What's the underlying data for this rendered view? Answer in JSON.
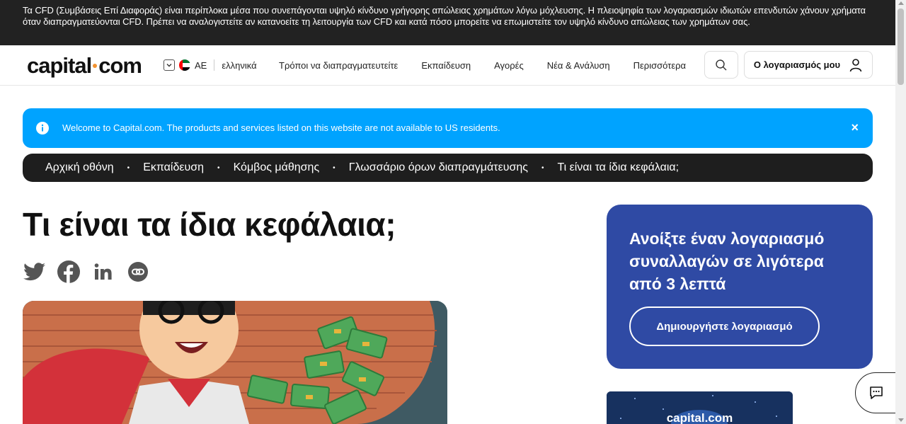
{
  "risk_warning": "Τα CFD (Συμβάσεις Επί Διαφοράς) είναι περίπλοκα μέσα που συνεπάγονται υψηλό κίνδυνο γρήγορης απώλειας χρημάτων λόγω μόχλευσης. Η πλειοψηφία των λογαριασμών ιδιωτών επενδυτών χάνουν χρήματα όταν διαπραγματεύονται CFD. Πρέπει να αναλογιστείτε αν κατανοείτε τη λειτουργία των CFD και κατά πόσο μπορείτε να επωμιστείτε τον υψηλό κίνδυνο απώλειας των χρημάτων σας.",
  "header": {
    "logo_left": "capital",
    "logo_right": "com",
    "region_code": "AE",
    "language": "ελληνικά",
    "nav": [
      "Τρόποι να διαπραγματευτείτε",
      "Εκπαίδευση",
      "Αγορές",
      "Νέα & Ανάλυση",
      "Περισσότερα"
    ],
    "account_label": "Ο λογαριασμός μου"
  },
  "banner": {
    "text": "Welcome to Capital.com. The products and services listed on this website are not available to US residents.",
    "close": "×"
  },
  "breadcrumbs": [
    "Αρχική οθόνη",
    "Εκπαίδευση",
    "Κόμβος μάθησης",
    "Γλωσσάριο όρων διαπραγμάτευσης",
    "Τι είναι τα ίδια κεφάλαια;"
  ],
  "page_title": "Τι είναι τα ίδια κεφάλαια;",
  "share_icons": [
    "twitter-icon",
    "facebook-icon",
    "linkedin-icon",
    "copy-link-icon"
  ],
  "promo": {
    "title": "Ανοίξτε έναν λογαριασμό συναλλαγών σε λιγότερα από 3 λεπτά",
    "button": "Δημιουργήστε λογαριασμό"
  },
  "card2_logo": "capital.com",
  "colors": {
    "risk_bg": "#222222",
    "banner": "#00a3ff",
    "promo": "#2f4aa4",
    "accent_dot": "#f29230"
  }
}
